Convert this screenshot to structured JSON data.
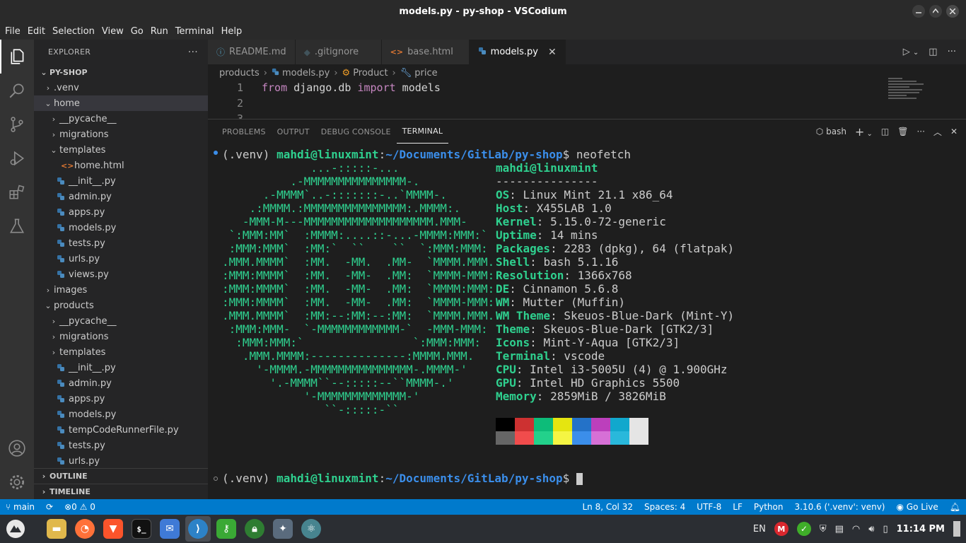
{
  "window": {
    "title": "models.py - py-shop - VSCodium"
  },
  "menu": [
    "File",
    "Edit",
    "Selection",
    "View",
    "Go",
    "Run",
    "Terminal",
    "Help"
  ],
  "explorer": {
    "header": "EXPLORER",
    "more": "···",
    "root": "PY-SHOP",
    "items": [
      {
        "label": ".venv",
        "depth": 1,
        "kind": "folder-closed"
      },
      {
        "label": "home",
        "depth": 1,
        "kind": "folder-open"
      },
      {
        "label": "__pycache__",
        "depth": 2,
        "kind": "folder-closed"
      },
      {
        "label": "migrations",
        "depth": 2,
        "kind": "folder-closed"
      },
      {
        "label": "templates",
        "depth": 2,
        "kind": "folder-open"
      },
      {
        "label": "home.html",
        "depth": 3,
        "kind": "html"
      },
      {
        "label": "__init__.py",
        "depth": 2,
        "kind": "py"
      },
      {
        "label": "admin.py",
        "depth": 2,
        "kind": "py"
      },
      {
        "label": "apps.py",
        "depth": 2,
        "kind": "py"
      },
      {
        "label": "models.py",
        "depth": 2,
        "kind": "py"
      },
      {
        "label": "tests.py",
        "depth": 2,
        "kind": "py"
      },
      {
        "label": "urls.py",
        "depth": 2,
        "kind": "py"
      },
      {
        "label": "views.py",
        "depth": 2,
        "kind": "py"
      },
      {
        "label": "images",
        "depth": 1,
        "kind": "folder-closed"
      },
      {
        "label": "products",
        "depth": 1,
        "kind": "folder-open"
      },
      {
        "label": "__pycache__",
        "depth": 2,
        "kind": "folder-closed"
      },
      {
        "label": "migrations",
        "depth": 2,
        "kind": "folder-closed"
      },
      {
        "label": "templates",
        "depth": 2,
        "kind": "folder-closed"
      },
      {
        "label": "__init__.py",
        "depth": 2,
        "kind": "py"
      },
      {
        "label": "admin.py",
        "depth": 2,
        "kind": "py"
      },
      {
        "label": "apps.py",
        "depth": 2,
        "kind": "py"
      },
      {
        "label": "models.py",
        "depth": 2,
        "kind": "py"
      },
      {
        "label": "tempCodeRunnerFile.py",
        "depth": 2,
        "kind": "py"
      },
      {
        "label": "tests.py",
        "depth": 2,
        "kind": "py"
      },
      {
        "label": "urls.py",
        "depth": 2,
        "kind": "py"
      }
    ],
    "outline": "OUTLINE",
    "timeline": "TIMELINE"
  },
  "tabs": [
    {
      "label": "README.md",
      "icon": "info-icon",
      "active": false
    },
    {
      "label": ".gitignore",
      "icon": "gitignore-icon",
      "active": false
    },
    {
      "label": "base.html",
      "icon": "html-icon",
      "active": false
    },
    {
      "label": "models.py",
      "icon": "python-icon",
      "active": true
    }
  ],
  "breadcrumb": {
    "folder": "products",
    "file": "models.py",
    "class": "Product",
    "field": "price"
  },
  "code": {
    "line_numbers": [
      "1",
      "2",
      "3"
    ],
    "kw_from": "from",
    "module": " django.db ",
    "kw_import": "import",
    "name": " models"
  },
  "panel": {
    "tabs": [
      "PROBLEMS",
      "OUTPUT",
      "DEBUG CONSOLE",
      "TERMINAL"
    ],
    "active_tab": "TERMINAL",
    "shell": "bash"
  },
  "terminal": {
    "venv": "(.venv) ",
    "user_host": "mahdi@linuxmint",
    "colon": ":",
    "path": "~/Documents/GitLab/py-shop",
    "dollar": "$ ",
    "command": "neofetch",
    "logo": [
      "             ...-:::::-...",
      "          .-MMMMMMMMMMMMMMM-.",
      "      .-MMMM`..-:::::::-..`MMMM-.",
      "    .:MMMM.:MMMMMMMMMMMMMMM:.MMMM:.",
      "   -MMM-M---MMMMMMMMMMMMMMMMMMM.MMM-",
      " `:MMM:MM`  :MMMM:....::-...-MMMM:MMM:`",
      " :MMM:MMM`  :MM:`  ``    ``  `:MMM:MMM:",
      ".MMM.MMMM`  :MM.  -MM.  .MM-  `MMMM.MMM.",
      ":MMM:MMMM`  :MM.  -MM-  .MM:  `MMMM-MMM:",
      ":MMM:MMMM`  :MM.  -MM-  .MM:  `MMMM:MMM:",
      ":MMM:MMMM`  :MM.  -MM-  .MM:  `MMMM-MMM:",
      ".MMM.MMMM`  :MM:--:MM:--:MM:  `MMMM.MMM.",
      " :MMM:MMM-  `-MMMMMMMMMMMM-`  -MMM-MMM:",
      "  :MMM:MMM:`                `:MMM:MMM:",
      "   .MMM.MMMM:--------------:MMMM.MMM.",
      "     '-MMMM.-MMMMMMMMMMMMMMM-.MMMM-'",
      "       '.-MMMM``--:::::--``MMMM-.'",
      "            '-MMMMMMMMMMMMM-'",
      "               ``-:::::-``"
    ],
    "info_title": "mahdi@linuxmint",
    "info_rule": "---------------",
    "info": [
      {
        "key": "OS",
        "value": "Linux Mint 21.1 x86_64"
      },
      {
        "key": "Host",
        "value": "X455LAB 1.0"
      },
      {
        "key": "Kernel",
        "value": "5.15.0-72-generic"
      },
      {
        "key": "Uptime",
        "value": "14 mins"
      },
      {
        "key": "Packages",
        "value": "2283 (dpkg), 64 (flatpak)"
      },
      {
        "key": "Shell",
        "value": "bash 5.1.16"
      },
      {
        "key": "Resolution",
        "value": "1366x768"
      },
      {
        "key": "DE",
        "value": "Cinnamon 5.6.8"
      },
      {
        "key": "WM",
        "value": "Mutter (Muffin)"
      },
      {
        "key": "WM Theme",
        "value": "Skeuos-Blue-Dark (Mint-Y)"
      },
      {
        "key": "Theme",
        "value": "Skeuos-Blue-Dark [GTK2/3]"
      },
      {
        "key": "Icons",
        "value": "Mint-Y-Aqua [GTK2/3]"
      },
      {
        "key": "Terminal",
        "value": "vscode"
      },
      {
        "key": "CPU",
        "value": "Intel i3-5005U (4) @ 1.900GHz"
      },
      {
        "key": "GPU",
        "value": "Intel HD Graphics 5500"
      },
      {
        "key": "Memory",
        "value": "2859MiB / 3826MiB"
      }
    ],
    "palette_top": [
      "#000000",
      "#cd3131",
      "#0dbc79",
      "#e5e510",
      "#2472c8",
      "#bc3fbc",
      "#11a8cd",
      "#e5e5e5"
    ],
    "palette_bottom": [
      "#666666",
      "#f14c4c",
      "#23d18b",
      "#f5f543",
      "#3b8eea",
      "#d670d6",
      "#29b8db",
      "#e5e5e5"
    ]
  },
  "status": {
    "branch": "main",
    "problems": "0",
    "warnings": "0",
    "position": "Ln 8, Col 32",
    "spaces": "Spaces: 4",
    "encoding": "UTF-8",
    "eol": "LF",
    "language": "Python",
    "interpreter": "3.10.6 ('.venv': venv)",
    "golive": "Go Live"
  },
  "taskbar": {
    "lang": "EN",
    "clock": "11:14 PM"
  },
  "colors": {
    "statusbar": "#007acc",
    "terminal_green": "#2fd08f",
    "terminal_blue": "#3b8eea"
  }
}
